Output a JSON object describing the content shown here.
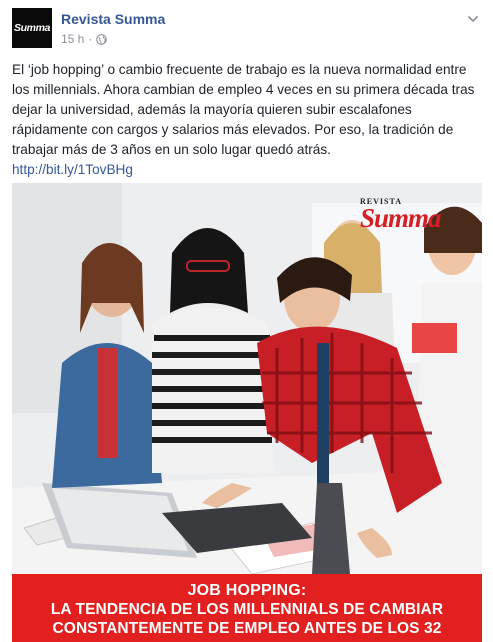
{
  "post": {
    "page_name": "Revista Summa",
    "avatar_text": "Summa",
    "timestamp": "15 h",
    "separator": "·",
    "privacy_icon": "globe-icon",
    "menu_icon": "chevron-down-icon",
    "text": "El ‘job hopping’ o cambio frecuente de trabajo es la nueva normalidad entre los millennials. Ahora cambian de empleo 4 veces en su primera década tras dejar la universidad, además la mayoría quieren subir escalafones rápidamente con cargos y salarios más elevados. Por eso, la tradición de trabajar más de 3 años en un solo lugar quedó atrás.",
    "link": "http://bit.ly/1TovBHg"
  },
  "image": {
    "logo_small": "REVISTA",
    "logo_big": "Summa",
    "banner_line1": "JOB HOPPING:",
    "banner_line2": "LA TENDENCIA DE LOS MILLENNIALS DE CAMBIAR",
    "banner_line3": "CONSTANTEMENTE DE EMPLEO ANTES DE LOS 32"
  },
  "colors": {
    "link": "#365899",
    "meta": "#90949c",
    "banner": "#e2201f",
    "logo_red": "#d51f26"
  }
}
